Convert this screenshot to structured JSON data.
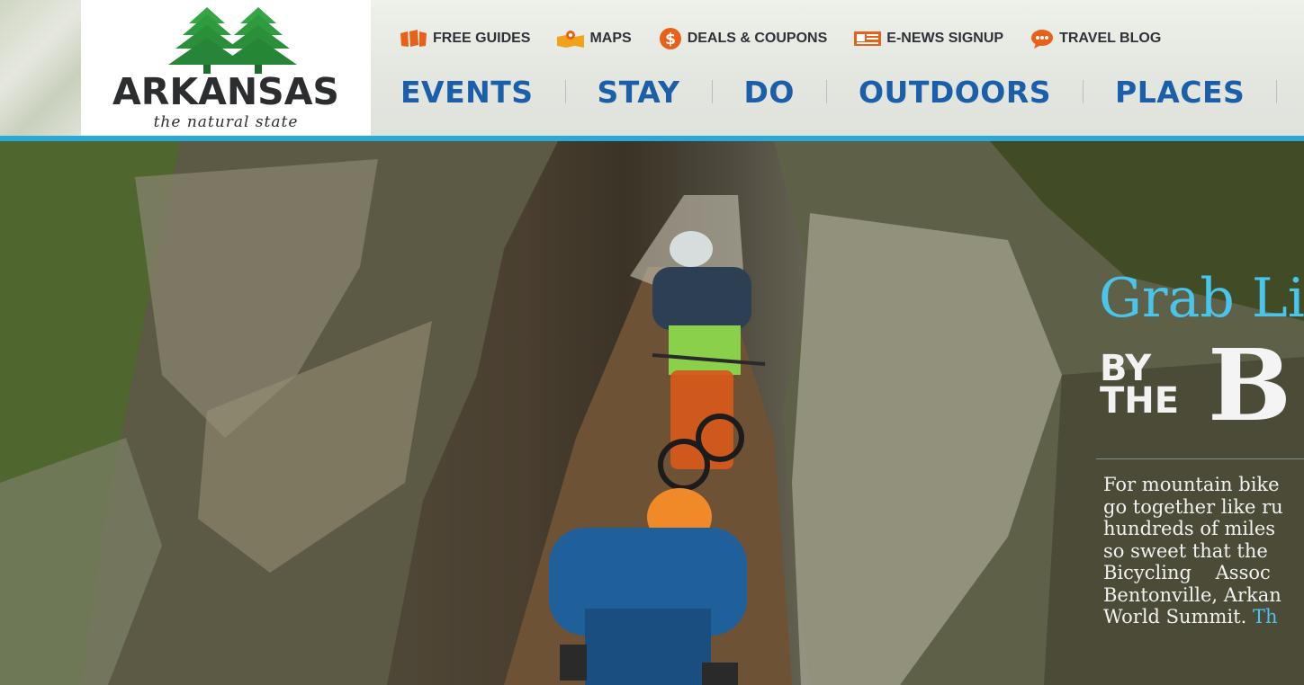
{
  "brand": {
    "logo_word": "ARKANSAS",
    "tagline": "the natural state",
    "tree_color": "#2e9a3e"
  },
  "utility_nav": [
    {
      "label": "FREE GUIDES",
      "icon": "guide-books-icon"
    },
    {
      "label": "MAPS",
      "icon": "map-icon"
    },
    {
      "label": "DEALS & COUPONS",
      "icon": "dollar-icon"
    },
    {
      "label": "E-NEWS SIGNUP",
      "icon": "newsletter-icon"
    },
    {
      "label": "TRAVEL BLOG",
      "icon": "chat-bubble-icon"
    }
  ],
  "main_nav": [
    {
      "label": "EVENTS"
    },
    {
      "label": "STAY"
    },
    {
      "label": "DO"
    },
    {
      "label": "OUTDOORS"
    },
    {
      "label": "PLACES"
    }
  ],
  "hero": {
    "title": "Grab Li",
    "by_the": [
      "BY",
      "THE"
    ],
    "big_text": "B",
    "body_lines": [
      "For mountain bike",
      "go together like ru",
      "hundreds of miles",
      "so sweet that the",
      "Bicycling    Assoc",
      "Bentonville, Arkan"
    ],
    "last_line_text": "World Summit.",
    "last_line_link": "Th"
  },
  "colors": {
    "accent_blue": "#29a9d8",
    "nav_blue": "#1b5ea9",
    "hero_title": "#4ac4e9",
    "util_icon_orange": "#e8611a"
  }
}
